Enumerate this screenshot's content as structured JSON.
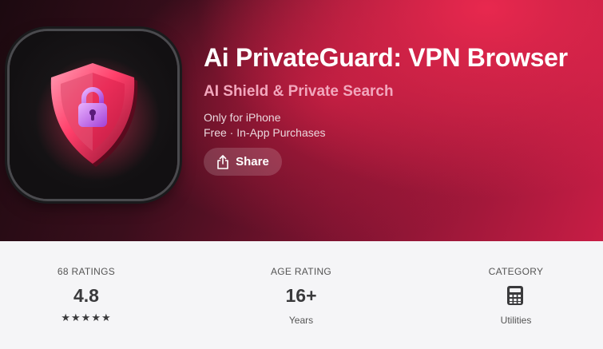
{
  "app": {
    "title": "Ai PrivateGuard: VPN Browser",
    "subtitle": "AI Shield & Private Search",
    "availability": "Only for iPhone",
    "price": "Free · In-App Purchases",
    "share_label": "Share",
    "icon": "shield-lock-icon"
  },
  "stats": {
    "ratings": {
      "label": "68 RATINGS",
      "value": "4.8",
      "stars": "★★★★★",
      "star_count": 5
    },
    "age": {
      "label": "AGE RATING",
      "value": "16+",
      "sub": "Years"
    },
    "category": {
      "label": "CATEGORY",
      "icon": "calculator-icon",
      "sub": "Utilities"
    }
  },
  "colors": {
    "hero_dark": "#1c0a10",
    "hero_accent": "#e8284e",
    "subtitle": "#f2a7bd",
    "stats_bg": "#f5f5f7"
  }
}
